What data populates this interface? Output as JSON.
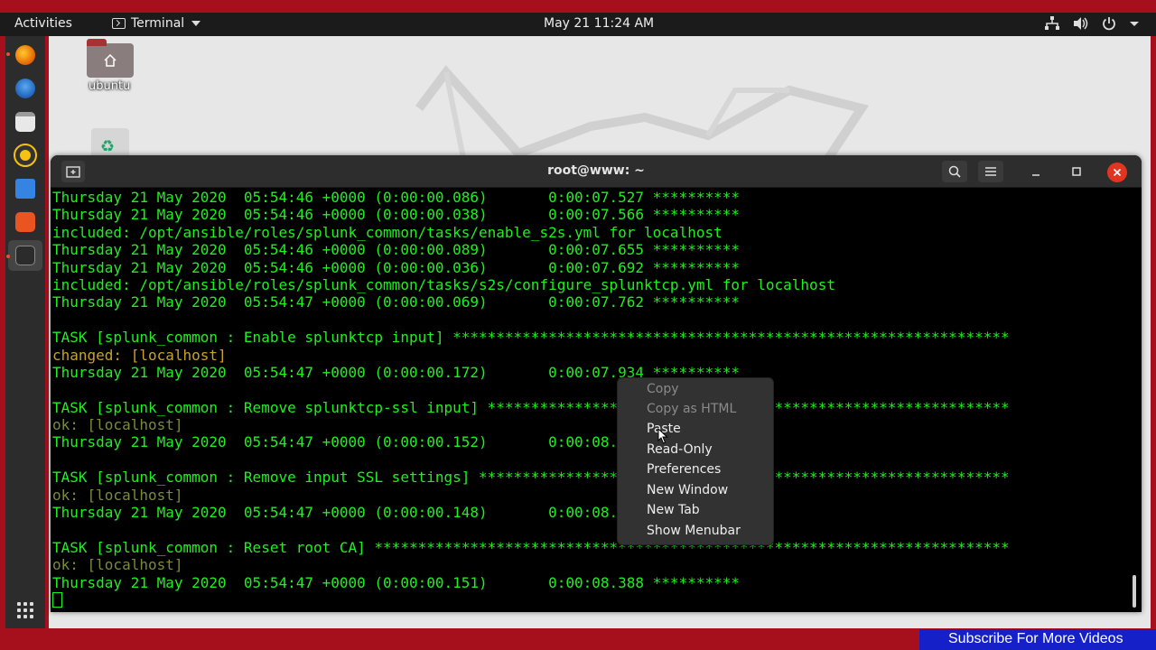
{
  "topbar": {
    "activities": "Activities",
    "app_menu": "Terminal",
    "clock": "May 21  11:24 AM"
  },
  "desktop": {
    "home_label": "ubuntu"
  },
  "terminal": {
    "title": "root@www: ~",
    "lines": [
      {
        "text": "Thursday 21 May 2020  05:54:46 +0000 (0:00:00.086)       0:00:07.527 **********",
        "color": "green"
      },
      {
        "text": "Thursday 21 May 2020  05:54:46 +0000 (0:00:00.038)       0:00:07.566 **********",
        "color": "green"
      },
      {
        "text": "included: /opt/ansible/roles/splunk_common/tasks/enable_s2s.yml for localhost",
        "color": "green"
      },
      {
        "text": "Thursday 21 May 2020  05:54:46 +0000 (0:00:00.089)       0:00:07.655 **********",
        "color": "green"
      },
      {
        "text": "Thursday 21 May 2020  05:54:46 +0000 (0:00:00.036)       0:00:07.692 **********",
        "color": "green"
      },
      {
        "text": "included: /opt/ansible/roles/splunk_common/tasks/s2s/configure_splunktcp.yml for localhost",
        "color": "green"
      },
      {
        "text": "Thursday 21 May 2020  05:54:47 +0000 (0:00:00.069)       0:00:07.762 **********",
        "color": "green"
      },
      {
        "text": "",
        "color": "green"
      },
      {
        "text": "TASK [splunk_common : Enable splunktcp input] ****************************************************************",
        "color": "green"
      },
      {
        "text": "changed: [localhost]",
        "color": "yellow"
      },
      {
        "text": "Thursday 21 May 2020  05:54:47 +0000 (0:00:00.172)       0:00:07.934 **********",
        "color": "green"
      },
      {
        "text": "",
        "color": "green"
      },
      {
        "text": "TASK [splunk_common : Remove splunktcp-ssl input] ************************************************************",
        "color": "green"
      },
      {
        "text": "ok: [localhost]",
        "color": "olive"
      },
      {
        "text": "Thursday 21 May 2020  05:54:47 +0000 (0:00:00.152)       0:00:08.086 **********",
        "color": "green"
      },
      {
        "text": "",
        "color": "green"
      },
      {
        "text": "TASK [splunk_common : Remove input SSL settings] *************************************************************",
        "color": "green"
      },
      {
        "text": "ok: [localhost]",
        "color": "olive"
      },
      {
        "text": "Thursday 21 May 2020  05:54:47 +0000 (0:00:00.148)       0:00:08.237 **********",
        "color": "green"
      },
      {
        "text": "",
        "color": "green"
      },
      {
        "text": "TASK [splunk_common : Reset root CA] *************************************************************************",
        "color": "green"
      },
      {
        "text": "ok: [localhost]",
        "color": "olive"
      },
      {
        "text": "Thursday 21 May 2020  05:54:47 +0000 (0:00:00.151)       0:00:08.388 **********",
        "color": "green"
      }
    ]
  },
  "context_menu": {
    "items": [
      {
        "label": "Copy",
        "enabled": false
      },
      {
        "label": "Copy as HTML",
        "enabled": false
      },
      {
        "label": "Paste",
        "enabled": true
      },
      {
        "label": "Read-Only",
        "enabled": true
      },
      {
        "label": "Preferences",
        "enabled": true
      },
      {
        "label": "New Window",
        "enabled": true
      },
      {
        "label": "New Tab",
        "enabled": true
      },
      {
        "label": "Show Menubar",
        "enabled": true
      }
    ]
  },
  "overlay": {
    "subscribe": "Subscribe For More Videos"
  },
  "colors": {
    "terminal_green": "#1ff01f",
    "changed_yellow": "#c9a227",
    "ok_olive": "#7b8a3b",
    "close_red": "#e0351f",
    "frame_red": "#a6101d",
    "banner_blue": "#1520c8"
  },
  "icons": {
    "dock": [
      "firefox-icon",
      "thunderbird-icon",
      "files-icon",
      "rhythmbox-icon",
      "writer-icon",
      "software-icon",
      "terminal-icon",
      "show-apps-icon"
    ],
    "tray": [
      "network-icon",
      "volume-icon",
      "power-icon",
      "chevron-down-icon"
    ]
  }
}
